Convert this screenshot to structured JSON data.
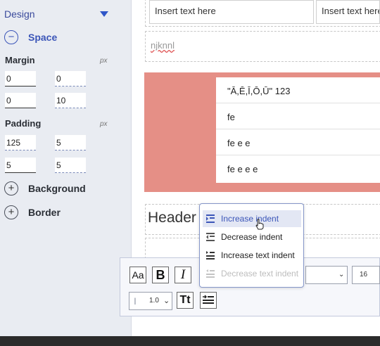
{
  "panel": {
    "design_label": "Design",
    "space_label": "Space",
    "margin_label": "Margin",
    "margin_unit": "px",
    "margin_values": [
      "0",
      "0",
      "0",
      "10"
    ],
    "padding_label": "Padding",
    "padding_unit": "px",
    "padding_values": [
      "125",
      "5",
      "5",
      "5"
    ],
    "background_label": "Background",
    "border_label": "Border"
  },
  "canvas": {
    "insert_text_1": "Insert text here",
    "insert_text_2": "Insert text here",
    "misspelled_text": "njknnl",
    "table_rows": [
      "\"Ā,Ē,Ī,Ō,Ū\" 123",
      "fe",
      "fe e e",
      "fe e e e"
    ],
    "header_text": "Header"
  },
  "menu": {
    "items": [
      {
        "label": "Increase indent",
        "state": "highlighted"
      },
      {
        "label": "Decrease indent",
        "state": "normal"
      },
      {
        "label": "Increase text indent",
        "state": "normal"
      },
      {
        "label": "Decrease text indent",
        "state": "disabled"
      }
    ]
  },
  "toolbar": {
    "font_size_button": "Aa",
    "bold_button": "B",
    "italic_button": "I",
    "font_size_value": "16",
    "line_height_value": "1.0",
    "text_transform_button": "Tt",
    "accent_color": "#3b55b8"
  }
}
